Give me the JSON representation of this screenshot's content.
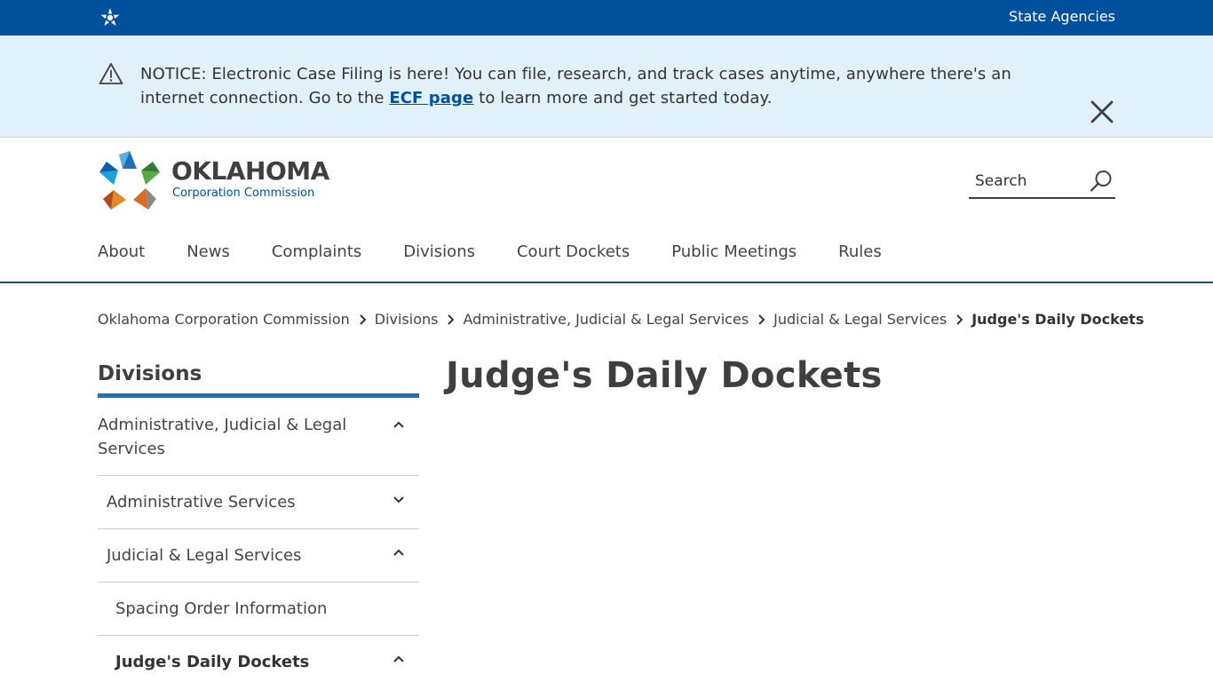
{
  "topbar": {
    "agencies_label": "State Agencies",
    "bg_color": "#00509e"
  },
  "notice": {
    "text_before": "NOTICE: Electronic Case Filing is here! You can file, research, and track cases anytime, anywhere there's an internet connection. Go to the ",
    "link_text": "ECF page",
    "text_after": " to learn more and get started today.",
    "bg_color": "#e1f1fa",
    "icons": [
      "warning-icon",
      "close-icon"
    ]
  },
  "header": {
    "logo_name": "OKLAHOMA",
    "logo_subtitle": "Corporation Commission",
    "search_placeholder": "Search"
  },
  "nav": {
    "items": [
      "About",
      "News",
      "Complaints",
      "Divisions",
      "Court Dockets",
      "Public Meetings",
      "Rules"
    ]
  },
  "breadcrumb": {
    "items": [
      "Oklahoma Corporation Commission",
      "Divisions",
      "Administrative, Judicial & Legal Services",
      "Judicial & Legal Services"
    ],
    "current": "Judge's Daily Dockets"
  },
  "sidebar": {
    "heading": "Divisions",
    "items": [
      {
        "label": "Administrative, Judicial & Legal Services",
        "state": "expanded"
      },
      {
        "label": "Administrative Services",
        "state": "collapsed"
      },
      {
        "label": "Judicial & Legal Services",
        "state": "expanded"
      },
      {
        "label": "Spacing Order Information",
        "state": "none"
      },
      {
        "label": "Judge's Daily Dockets",
        "state": "expanded",
        "active": true
      }
    ]
  },
  "main": {
    "title": "Judge's Daily Dockets"
  }
}
